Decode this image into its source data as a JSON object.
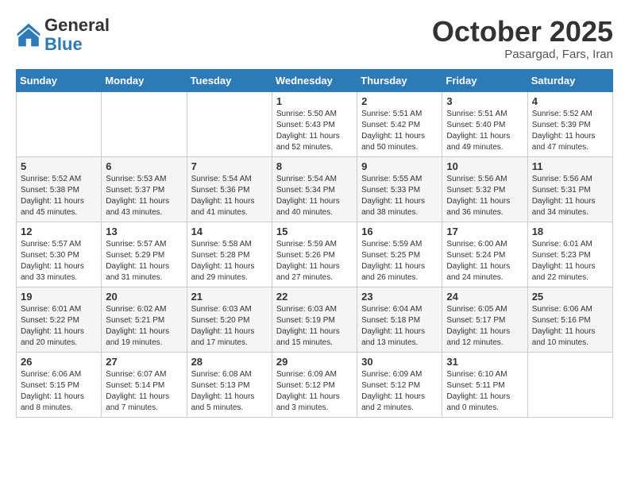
{
  "header": {
    "logo_general": "General",
    "logo_blue": "Blue",
    "month": "October 2025",
    "location": "Pasargad, Fars, Iran"
  },
  "weekdays": [
    "Sunday",
    "Monday",
    "Tuesday",
    "Wednesday",
    "Thursday",
    "Friday",
    "Saturday"
  ],
  "weeks": [
    [
      {
        "day": "",
        "text": ""
      },
      {
        "day": "",
        "text": ""
      },
      {
        "day": "",
        "text": ""
      },
      {
        "day": "1",
        "text": "Sunrise: 5:50 AM\nSunset: 5:43 PM\nDaylight: 11 hours\nand 52 minutes."
      },
      {
        "day": "2",
        "text": "Sunrise: 5:51 AM\nSunset: 5:42 PM\nDaylight: 11 hours\nand 50 minutes."
      },
      {
        "day": "3",
        "text": "Sunrise: 5:51 AM\nSunset: 5:40 PM\nDaylight: 11 hours\nand 49 minutes."
      },
      {
        "day": "4",
        "text": "Sunrise: 5:52 AM\nSunset: 5:39 PM\nDaylight: 11 hours\nand 47 minutes."
      }
    ],
    [
      {
        "day": "5",
        "text": "Sunrise: 5:52 AM\nSunset: 5:38 PM\nDaylight: 11 hours\nand 45 minutes."
      },
      {
        "day": "6",
        "text": "Sunrise: 5:53 AM\nSunset: 5:37 PM\nDaylight: 11 hours\nand 43 minutes."
      },
      {
        "day": "7",
        "text": "Sunrise: 5:54 AM\nSunset: 5:36 PM\nDaylight: 11 hours\nand 41 minutes."
      },
      {
        "day": "8",
        "text": "Sunrise: 5:54 AM\nSunset: 5:34 PM\nDaylight: 11 hours\nand 40 minutes."
      },
      {
        "day": "9",
        "text": "Sunrise: 5:55 AM\nSunset: 5:33 PM\nDaylight: 11 hours\nand 38 minutes."
      },
      {
        "day": "10",
        "text": "Sunrise: 5:56 AM\nSunset: 5:32 PM\nDaylight: 11 hours\nand 36 minutes."
      },
      {
        "day": "11",
        "text": "Sunrise: 5:56 AM\nSunset: 5:31 PM\nDaylight: 11 hours\nand 34 minutes."
      }
    ],
    [
      {
        "day": "12",
        "text": "Sunrise: 5:57 AM\nSunset: 5:30 PM\nDaylight: 11 hours\nand 33 minutes."
      },
      {
        "day": "13",
        "text": "Sunrise: 5:57 AM\nSunset: 5:29 PM\nDaylight: 11 hours\nand 31 minutes."
      },
      {
        "day": "14",
        "text": "Sunrise: 5:58 AM\nSunset: 5:28 PM\nDaylight: 11 hours\nand 29 minutes."
      },
      {
        "day": "15",
        "text": "Sunrise: 5:59 AM\nSunset: 5:26 PM\nDaylight: 11 hours\nand 27 minutes."
      },
      {
        "day": "16",
        "text": "Sunrise: 5:59 AM\nSunset: 5:25 PM\nDaylight: 11 hours\nand 26 minutes."
      },
      {
        "day": "17",
        "text": "Sunrise: 6:00 AM\nSunset: 5:24 PM\nDaylight: 11 hours\nand 24 minutes."
      },
      {
        "day": "18",
        "text": "Sunrise: 6:01 AM\nSunset: 5:23 PM\nDaylight: 11 hours\nand 22 minutes."
      }
    ],
    [
      {
        "day": "19",
        "text": "Sunrise: 6:01 AM\nSunset: 5:22 PM\nDaylight: 11 hours\nand 20 minutes."
      },
      {
        "day": "20",
        "text": "Sunrise: 6:02 AM\nSunset: 5:21 PM\nDaylight: 11 hours\nand 19 minutes."
      },
      {
        "day": "21",
        "text": "Sunrise: 6:03 AM\nSunset: 5:20 PM\nDaylight: 11 hours\nand 17 minutes."
      },
      {
        "day": "22",
        "text": "Sunrise: 6:03 AM\nSunset: 5:19 PM\nDaylight: 11 hours\nand 15 minutes."
      },
      {
        "day": "23",
        "text": "Sunrise: 6:04 AM\nSunset: 5:18 PM\nDaylight: 11 hours\nand 13 minutes."
      },
      {
        "day": "24",
        "text": "Sunrise: 6:05 AM\nSunset: 5:17 PM\nDaylight: 11 hours\nand 12 minutes."
      },
      {
        "day": "25",
        "text": "Sunrise: 6:06 AM\nSunset: 5:16 PM\nDaylight: 11 hours\nand 10 minutes."
      }
    ],
    [
      {
        "day": "26",
        "text": "Sunrise: 6:06 AM\nSunset: 5:15 PM\nDaylight: 11 hours\nand 8 minutes."
      },
      {
        "day": "27",
        "text": "Sunrise: 6:07 AM\nSunset: 5:14 PM\nDaylight: 11 hours\nand 7 minutes."
      },
      {
        "day": "28",
        "text": "Sunrise: 6:08 AM\nSunset: 5:13 PM\nDaylight: 11 hours\nand 5 minutes."
      },
      {
        "day": "29",
        "text": "Sunrise: 6:09 AM\nSunset: 5:12 PM\nDaylight: 11 hours\nand 3 minutes."
      },
      {
        "day": "30",
        "text": "Sunrise: 6:09 AM\nSunset: 5:12 PM\nDaylight: 11 hours\nand 2 minutes."
      },
      {
        "day": "31",
        "text": "Sunrise: 6:10 AM\nSunset: 5:11 PM\nDaylight: 11 hours\nand 0 minutes."
      },
      {
        "day": "",
        "text": ""
      }
    ]
  ]
}
